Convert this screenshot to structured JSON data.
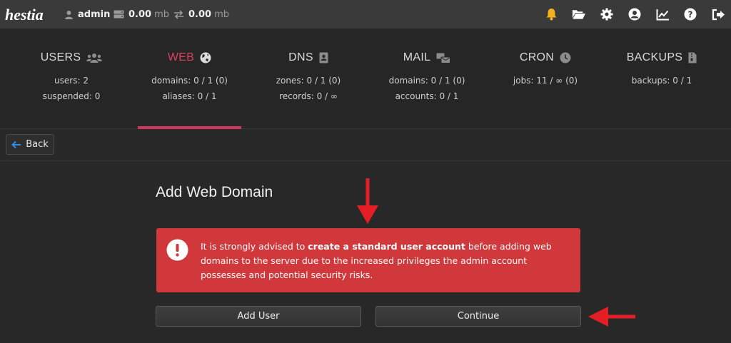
{
  "brand": {
    "logo_text": "hestia"
  },
  "topbar": {
    "user": "admin",
    "disk_value": "0.00",
    "disk_unit": "mb",
    "bandwidth_value": "0.00",
    "bandwidth_unit": "mb",
    "icons": [
      "bell-icon",
      "folder-open-icon",
      "gear-icon",
      "user-circle-icon",
      "chart-line-icon",
      "question-circle-icon",
      "sign-out-icon"
    ]
  },
  "stats": [
    {
      "title": "USERS",
      "icon": "users-icon",
      "line1": "users: 2",
      "line2": "suspended: 0"
    },
    {
      "title": "WEB",
      "icon": "globe-icon",
      "line1": "domains: 0 / 1 (0)",
      "line2": "aliases: 0 / 1",
      "active": true
    },
    {
      "title": "DNS",
      "icon": "address-book-icon",
      "line1": "zones: 0 / 1 (0)",
      "line2": "records: 0 / ∞"
    },
    {
      "title": "MAIL",
      "icon": "mail-bulk-icon",
      "line1": "domains: 0 / 1 (0)",
      "line2": "accounts: 0 / 1"
    },
    {
      "title": "CRON",
      "icon": "clock-icon",
      "line1": "jobs: 11 / ∞ (0)",
      "line2": ""
    },
    {
      "title": "BACKUPS",
      "icon": "file-archive-icon",
      "line1": "backups: 0 / 1",
      "line2": ""
    }
  ],
  "toolbar": {
    "back_label": "Back"
  },
  "page": {
    "title": "Add Web Domain",
    "alert": {
      "pre": "It is strongly advised to ",
      "strong": "create a standard user account",
      "post": " before adding web domains to the server due to the increased privileges the admin account possesses and potential security risks."
    },
    "add_user_label": "Add User",
    "continue_label": "Continue"
  },
  "colors": {
    "accent": "#d0375e",
    "alert_bg": "#d1383c",
    "notification": "#f2b21d",
    "annotation_arrow": "#e31e24"
  }
}
